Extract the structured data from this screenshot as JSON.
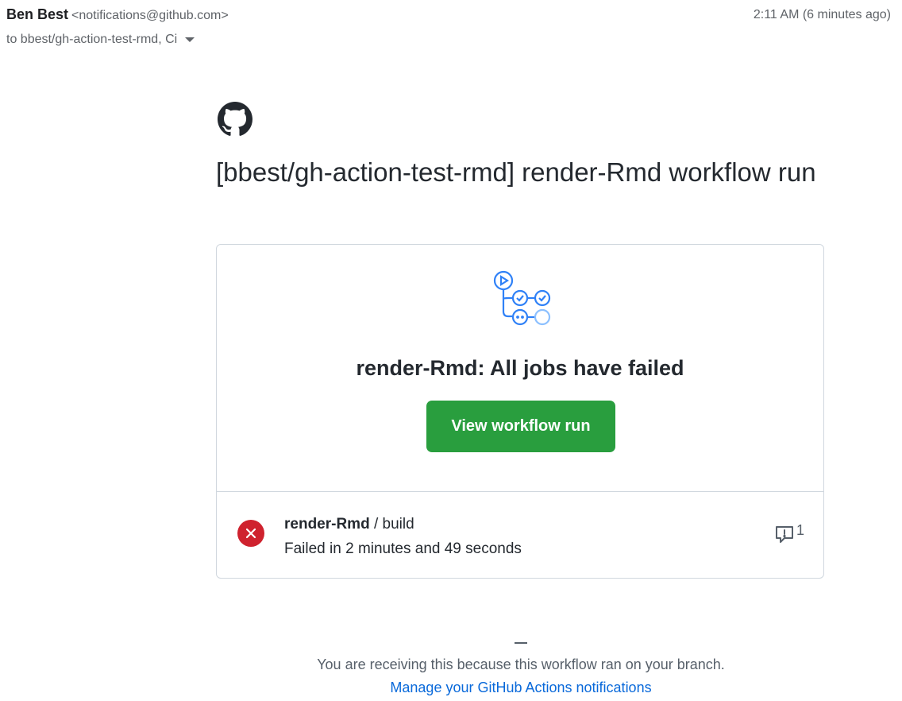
{
  "email": {
    "sender_name": "Ben Best",
    "sender_email": "<notifications@github.com>",
    "time": "2:11 AM (6 minutes ago)",
    "recipients": "to bbest/gh-action-test-rmd, Ci"
  },
  "body": {
    "title": "[bbest/gh-action-test-rmd] render-Rmd workflow run",
    "card": {
      "heading": "render-Rmd: All jobs have failed",
      "button_label": "View workflow run"
    },
    "job": {
      "name": "render-Rmd",
      "separator": " / ",
      "step": "build",
      "status": "Failed in 2 minutes and 49 seconds",
      "annotation_count": "1"
    },
    "footer": {
      "dash": "—",
      "text": "You are receiving this because this workflow ran on your branch.",
      "link": "Manage your GitHub Actions notifications"
    }
  },
  "colors": {
    "button": "#299e3e",
    "fail": "#cf222e",
    "link": "#0969da",
    "workflow_icon": "#2f81f7"
  },
  "icons": [
    "github-logo-icon",
    "workflow-icon",
    "x-circle-icon",
    "comment-alert-icon",
    "chevron-down-icon"
  ]
}
